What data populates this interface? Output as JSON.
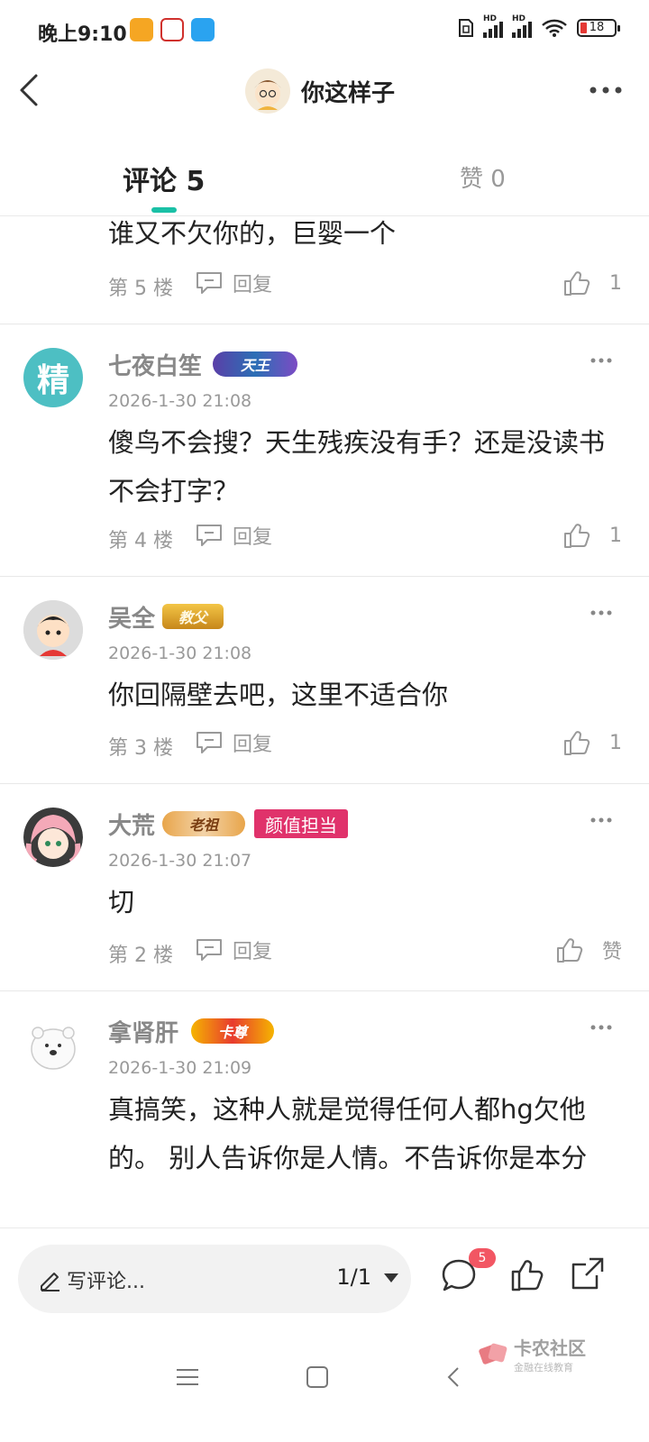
{
  "status_bar": {
    "time": "晚上9:10",
    "battery": "18",
    "signal_label": "HD"
  },
  "header": {
    "title": "你这样子"
  },
  "tabs": [
    {
      "label": "评论 5",
      "active": true
    },
    {
      "label": "赞 0",
      "active": false
    }
  ],
  "comments": [
    {
      "name": "",
      "badge": "",
      "tag": "",
      "time": "",
      "text": "谁又不欠你的，巨婴一个",
      "floor": "第 5 楼",
      "reply_label": "回复",
      "like": "1"
    },
    {
      "name": "七夜白笙",
      "badge": "天王",
      "tag": "",
      "avatar_text": "精",
      "time": "2026-1-30 21:08",
      "text": "傻鸟不会搜？天生残疾没有手？还是没读书不会打字？",
      "floor": "第 4 楼",
      "reply_label": "回复",
      "like": "1"
    },
    {
      "name": "吴全",
      "badge": "教父",
      "tag": "",
      "time": "2026-1-30 21:08",
      "text": "你回隔壁去吧，这里不适合你",
      "floor": "第 3 楼",
      "reply_label": "回复",
      "like": "1"
    },
    {
      "name": "大荒",
      "badge": "老祖",
      "tag": "颜值担当",
      "time": "2026-1-30 21:07",
      "text": "切",
      "floor": "第 2 楼",
      "reply_label": "回复",
      "like": "赞"
    },
    {
      "name": "拿肾肝",
      "badge": "卡尊",
      "tag": "",
      "time": "2026-1-30 21:09",
      "text": "真搞笑，这种人就是觉得任何人都hg欠他的。 别人告诉你是人情。不告诉你是本分",
      "floor": "",
      "reply_label": "",
      "like": ""
    }
  ],
  "bottom_bar": {
    "placeholder": "写评论...",
    "page": "1/1",
    "comment_count": "5"
  },
  "watermark": {
    "title": "卡农社区",
    "subtitle": "金融在线教育"
  },
  "colors": {
    "accent": "#1ac0a6",
    "tag_pink": "#e0326b",
    "badge_red": "#f25663"
  }
}
